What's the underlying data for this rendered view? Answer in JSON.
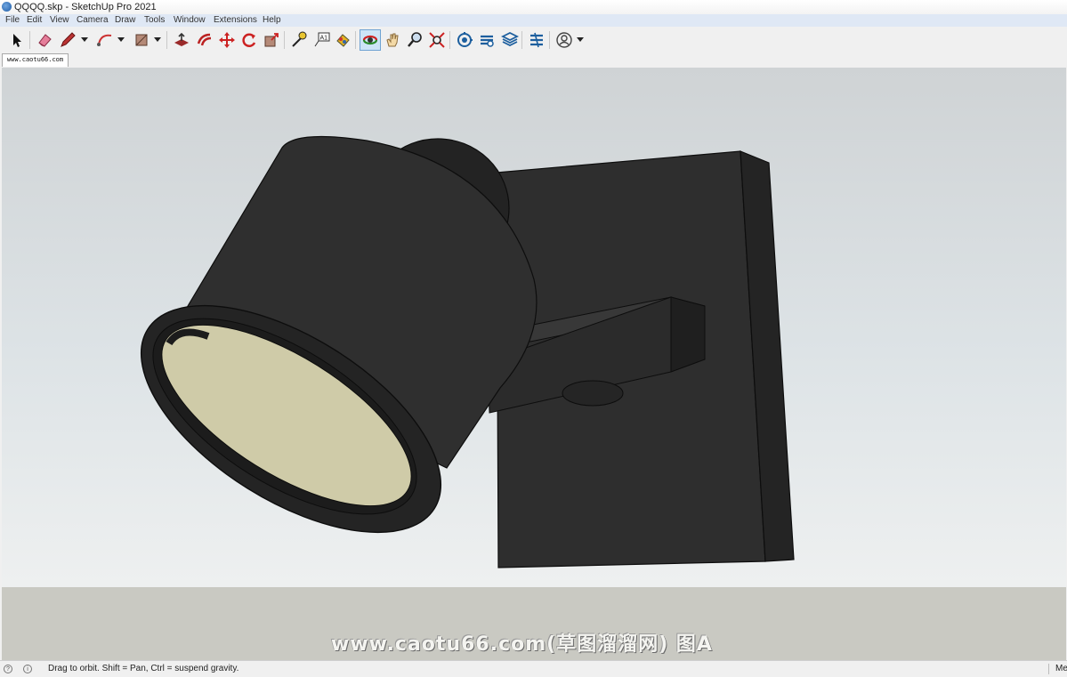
{
  "window": {
    "title": "QQQQ.skp - SketchUp Pro 2021",
    "icon": "sketchup-logo-icon"
  },
  "menu": [
    "File",
    "Edit",
    "View",
    "Camera",
    "Draw",
    "Tools",
    "Window",
    "Extensions",
    "Help"
  ],
  "toolbar": {
    "tools": [
      {
        "name": "select-tool-icon"
      },
      {
        "name": "eraser-tool-icon"
      },
      {
        "name": "pencil-line-tool-icon",
        "dropdown": true
      },
      {
        "name": "arc-tool-icon",
        "dropdown": true
      },
      {
        "name": "rectangle-shape-tool-icon",
        "dropdown": true
      },
      {
        "name": "push-pull-tool-icon"
      },
      {
        "name": "offset-tool-icon"
      },
      {
        "name": "move-tool-icon"
      },
      {
        "name": "rotate-tool-icon"
      },
      {
        "name": "scale-tool-icon"
      },
      {
        "name": "tape-measure-tool-icon"
      },
      {
        "name": "text-tool-icon"
      },
      {
        "name": "paint-bucket-tool-icon"
      },
      {
        "name": "orbit-tool-icon",
        "active": true
      },
      {
        "name": "pan-tool-icon"
      },
      {
        "name": "zoom-tool-icon"
      },
      {
        "name": "zoom-extents-tool-icon"
      },
      {
        "name": "3d-warehouse-icon"
      },
      {
        "name": "extension-warehouse-icon"
      },
      {
        "name": "layout-icon"
      },
      {
        "name": "extension-manager-icon"
      },
      {
        "name": "account-icon",
        "dropdown": true
      }
    ]
  },
  "scene_tab": {
    "label": "www.caotu66.com"
  },
  "viewport": {
    "model": "wall-mounted-spotlight",
    "colors": {
      "body": "#2f2f2f",
      "body_dark": "#1f1f1f",
      "lens": "#cfcba8",
      "ground": "#c9c9c2"
    }
  },
  "watermark": {
    "text": "www.caotu66.com(草图溜溜网) 图A"
  },
  "statusbar": {
    "message": "Drag to orbit. Shift = Pan, Ctrl = suspend gravity.",
    "measurements_label": "Me"
  }
}
